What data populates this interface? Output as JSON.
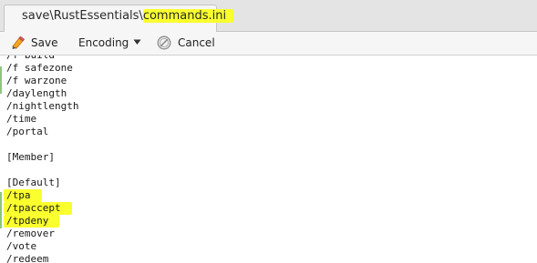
{
  "tab": {
    "path_prefix": "save\\RustEssentials\\",
    "file_name": "commands.ini"
  },
  "toolbar": {
    "save_label": "Save",
    "save_icon": "save-icon",
    "encoding_label": "Encoding",
    "encoding_icon": "dropdown-triangle-icon",
    "cancel_label": "Cancel",
    "cancel_icon": "cancel-icon"
  },
  "editor": {
    "lines": [
      {
        "text": "/f build",
        "highlight": false
      },
      {
        "text": "/f safezone",
        "highlight": false
      },
      {
        "text": "/f warzone",
        "highlight": false
      },
      {
        "text": "/daylength",
        "highlight": false
      },
      {
        "text": "/nightlength",
        "highlight": false
      },
      {
        "text": "/time",
        "highlight": false
      },
      {
        "text": "/portal",
        "highlight": false
      },
      {
        "text": "",
        "highlight": false
      },
      {
        "text": "[Member]",
        "highlight": false
      },
      {
        "text": "",
        "highlight": false
      },
      {
        "text": "[Default]",
        "highlight": false
      },
      {
        "text": "/tpa",
        "highlight": true
      },
      {
        "text": "/tpaccept",
        "highlight": true
      },
      {
        "text": "/tpdeny",
        "highlight": true
      },
      {
        "text": "/remover",
        "highlight": false
      },
      {
        "text": "/vote",
        "highlight": false
      },
      {
        "text": "/redeem",
        "highlight": false
      }
    ]
  },
  "colors": {
    "highlight": "#faff2e",
    "gutter_mark": "#8fc67a"
  }
}
